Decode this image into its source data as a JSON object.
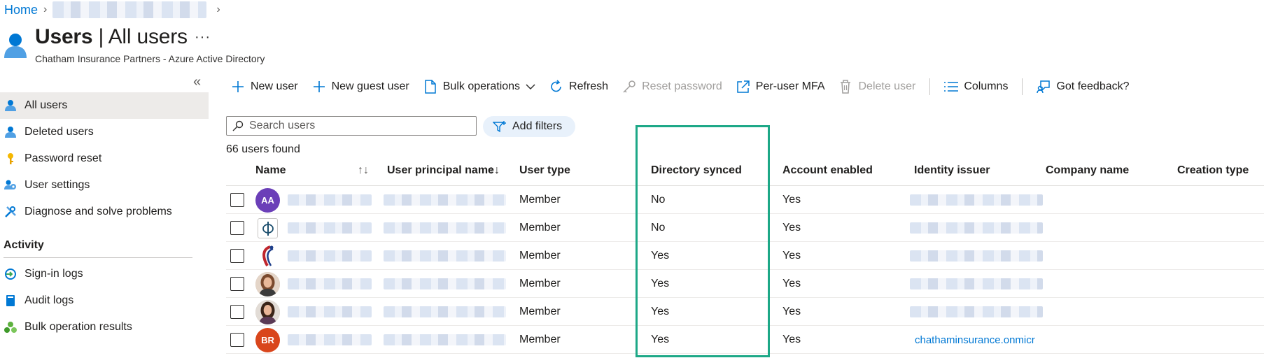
{
  "breadcrumb": {
    "home": "Home"
  },
  "header": {
    "title_bold": "Users",
    "title_rest": " | All users",
    "more": "···",
    "subtitle": "Chatham Insurance Partners - Azure Active Directory"
  },
  "sidebar": {
    "collapse_icon": "double-chevron-left-icon",
    "items": [
      {
        "label": "All users",
        "icon": "user-icon",
        "active": true
      },
      {
        "label": "Deleted users",
        "icon": "user-icon"
      },
      {
        "label": "Password reset",
        "icon": "key-icon"
      },
      {
        "label": "User settings",
        "icon": "user-settings-icon"
      },
      {
        "label": "Diagnose and solve problems",
        "icon": "wrench-icon"
      }
    ],
    "activity_heading": "Activity",
    "activity_items": [
      {
        "label": "Sign-in logs",
        "icon": "sign-in-icon"
      },
      {
        "label": "Audit logs",
        "icon": "book-icon"
      },
      {
        "label": "Bulk operation results",
        "icon": "bulk-icon"
      }
    ]
  },
  "toolbar": {
    "new_user": "New user",
    "new_guest_user": "New guest user",
    "bulk_operations": "Bulk operations",
    "refresh": "Refresh",
    "reset_password": "Reset password",
    "per_user_mfa": "Per-user MFA",
    "delete_user": "Delete user",
    "columns": "Columns",
    "got_feedback": "Got feedback?"
  },
  "search": {
    "placeholder": "Search users",
    "value": ""
  },
  "add_filters": "Add filters",
  "users_found": "66 users found",
  "table": {
    "columns": {
      "name": "Name",
      "upn": "User principal name",
      "user_type": "User type",
      "directory_synced": "Directory synced",
      "account_enabled": "Account enabled",
      "identity_issuer": "Identity issuer",
      "company_name": "Company name",
      "creation_type": "Creation type"
    },
    "sort_icons": {
      "name": "↑↓",
      "upn": "↑↓"
    },
    "rows": [
      {
        "avatar_initials": "AA",
        "avatar_color": "#6b3fb8",
        "user_type": "Member",
        "directory_synced": "No",
        "account_enabled": "Yes",
        "issuer": ""
      },
      {
        "avatar_initials": "",
        "avatar_kind": "phi-logo",
        "user_type": "Member",
        "directory_synced": "No",
        "account_enabled": "Yes",
        "issuer": ""
      },
      {
        "avatar_initials": "",
        "avatar_kind": "ribbon-logo",
        "user_type": "Member",
        "directory_synced": "Yes",
        "account_enabled": "Yes",
        "issuer": ""
      },
      {
        "avatar_initials": "",
        "avatar_kind": "photo",
        "user_type": "Member",
        "directory_synced": "Yes",
        "account_enabled": "Yes",
        "issuer": ""
      },
      {
        "avatar_initials": "",
        "avatar_kind": "photo",
        "user_type": "Member",
        "directory_synced": "Yes",
        "account_enabled": "Yes",
        "issuer": ""
      },
      {
        "avatar_initials": "BR",
        "avatar_color": "#d9461c",
        "user_type": "Member",
        "directory_synced": "Yes",
        "account_enabled": "Yes",
        "issuer": "chathaminsurance.onmicr"
      }
    ]
  },
  "colors": {
    "accent": "#0078d4",
    "highlight": "#1da887",
    "active_bg": "#edebe9"
  }
}
